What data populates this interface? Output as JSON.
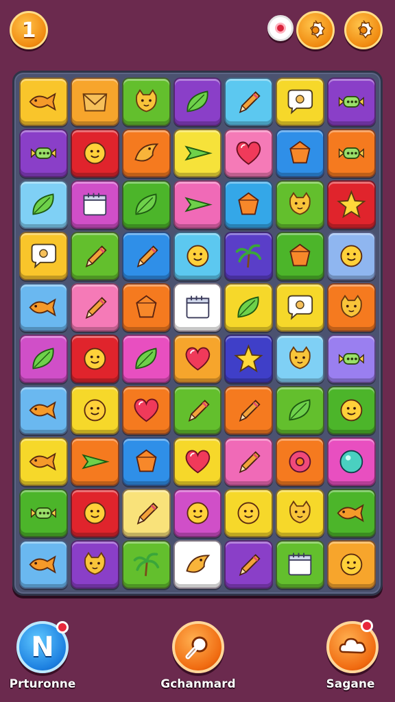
{
  "hud": {
    "level": "1",
    "record_icon": "record-icon",
    "settings_icons": [
      "gear-icon",
      "gear-icon"
    ]
  },
  "bottom_bar": {
    "left": {
      "label": "Prturonne",
      "glyph": "N",
      "icon": "n-badge-icon"
    },
    "center": {
      "label": "Gchanmard",
      "icon": "magnifier-icon"
    },
    "right": {
      "label": "Sagane",
      "icon": "cloud-icon"
    }
  },
  "board": {
    "rows": [
      [
        {
          "color": "#f9c52b",
          "icon": "fish"
        },
        {
          "color": "#f7a52c",
          "icon": "envelope"
        },
        {
          "color": "#63bf2d",
          "icon": "cat"
        },
        {
          "color": "#8a3fc8",
          "icon": "leaf"
        },
        {
          "color": "#5cc8f0",
          "icon": "pencil"
        },
        {
          "color": "#f6d82a",
          "icon": "chat"
        },
        {
          "color": "#8a3fc8",
          "icon": "candy"
        }
      ],
      [
        {
          "color": "#8a3fc8",
          "icon": "candy"
        },
        {
          "color": "#e0242c",
          "icon": "face"
        },
        {
          "color": "#f57a1f",
          "icon": "bird"
        },
        {
          "color": "#f6e23a",
          "icon": "plane"
        },
        {
          "color": "#f57ab7",
          "icon": "heart"
        },
        {
          "color": "#2f8fe8",
          "icon": "gem"
        },
        {
          "color": "#f57a1f",
          "icon": "candy"
        }
      ],
      [
        {
          "color": "#7fd0f5",
          "icon": "leaf"
        },
        {
          "color": "#d04fc8",
          "icon": "calendar"
        },
        {
          "color": "#4cb52a",
          "icon": "leaf"
        },
        {
          "color": "#f06ab7",
          "icon": "plane"
        },
        {
          "color": "#34a7e8",
          "icon": "gem"
        },
        {
          "color": "#63bf2d",
          "icon": "cat"
        },
        {
          "color": "#e0242c",
          "icon": "star"
        }
      ],
      [
        {
          "color": "#f9c52b",
          "icon": "chat"
        },
        {
          "color": "#63bf2d",
          "icon": "pencil"
        },
        {
          "color": "#2f8fe8",
          "icon": "pencil"
        },
        {
          "color": "#5cc8f0",
          "icon": "face"
        },
        {
          "color": "#5a3ec8",
          "icon": "palm"
        },
        {
          "color": "#4cb52a",
          "icon": "gem"
        },
        {
          "color": "#8fb6f0",
          "icon": "face"
        }
      ],
      [
        {
          "color": "#6ab8f0",
          "icon": "fish"
        },
        {
          "color": "#f57ab7",
          "icon": "pencil"
        },
        {
          "color": "#f57a1f",
          "icon": "gem"
        },
        {
          "color": "#ffffff",
          "icon": "calendar"
        },
        {
          "color": "#f6d82a",
          "icon": "leaf"
        },
        {
          "color": "#f6d82a",
          "icon": "chat"
        },
        {
          "color": "#f57a1f",
          "icon": "cat"
        }
      ],
      [
        {
          "color": "#d04fc8",
          "icon": "leaf"
        },
        {
          "color": "#e0242c",
          "icon": "face"
        },
        {
          "color": "#e84fc0",
          "icon": "leaf"
        },
        {
          "color": "#f6a52c",
          "icon": "heart"
        },
        {
          "color": "#3f3fc8",
          "icon": "star"
        },
        {
          "color": "#7fd0f5",
          "icon": "cat"
        },
        {
          "color": "#9a7ff0",
          "icon": "candy"
        }
      ],
      [
        {
          "color": "#6ab8f0",
          "icon": "fish"
        },
        {
          "color": "#f6d82a",
          "icon": "face"
        },
        {
          "color": "#f57a1f",
          "icon": "heart"
        },
        {
          "color": "#63bf2d",
          "icon": "pencil"
        },
        {
          "color": "#f57a1f",
          "icon": "pencil"
        },
        {
          "color": "#63bf2d",
          "icon": "leaf"
        },
        {
          "color": "#4cb52a",
          "icon": "face"
        }
      ],
      [
        {
          "color": "#f6d82a",
          "icon": "fish"
        },
        {
          "color": "#f57a1f",
          "icon": "plane"
        },
        {
          "color": "#2f8fe8",
          "icon": "gem"
        },
        {
          "color": "#f6d82a",
          "icon": "heart"
        },
        {
          "color": "#f06ab7",
          "icon": "pencil"
        },
        {
          "color": "#f57a1f",
          "icon": "donut"
        },
        {
          "color": "#e84fc0",
          "icon": "ball"
        }
      ],
      [
        {
          "color": "#4cb52a",
          "icon": "candy"
        },
        {
          "color": "#e0242c",
          "icon": "face"
        },
        {
          "color": "#f9e27a",
          "icon": "pencil"
        },
        {
          "color": "#d04fc8",
          "icon": "face"
        },
        {
          "color": "#f6d82a",
          "icon": "face"
        },
        {
          "color": "#f6d82a",
          "icon": "cat"
        },
        {
          "color": "#4cb52a",
          "icon": "fish"
        }
      ],
      [
        {
          "color": "#6ab8f0",
          "icon": "fish"
        },
        {
          "color": "#8a3fc8",
          "icon": "cat"
        },
        {
          "color": "#63bf2d",
          "icon": "palm"
        },
        {
          "color": "#ffffff",
          "icon": "bird"
        },
        {
          "color": "#8a3fc8",
          "icon": "pencil"
        },
        {
          "color": "#63bf2d",
          "icon": "calendar"
        },
        {
          "color": "#f7a52c",
          "icon": "face"
        }
      ]
    ]
  }
}
